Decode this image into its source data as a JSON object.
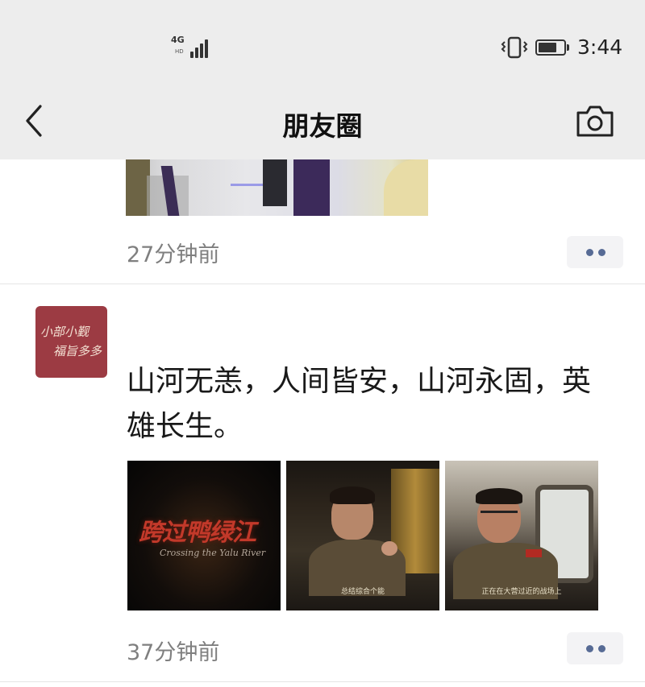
{
  "status_bar": {
    "network": "4G",
    "network_sub": "HD",
    "signal_icon": "signal-bars-icon",
    "vibrate_icon": "vibrate-icon",
    "battery_icon": "battery-icon",
    "battery_level": 0.6,
    "time": "3:44"
  },
  "nav": {
    "back_icon": "chevron-left-icon",
    "title": "朋友圈",
    "camera_icon": "camera-icon"
  },
  "feed": {
    "posts": [
      {
        "time": "27分钟前"
      },
      {
        "avatar_text": [
          "小部小觐",
          "福旨多多"
        ],
        "text": "山河无恙，人间皆安，山河永固，英雄长生。",
        "images": [
          {
            "title_text": "跨过鸭绿江",
            "subtitle_text": "Crossing the Yalu River"
          },
          {
            "caption": "总结综合个能"
          },
          {
            "caption": "正在在大营过近的战场上"
          }
        ],
        "time": "37分钟前"
      }
    ]
  },
  "colors": {
    "bar_bg": "#ededed",
    "link_blue": "#576b95",
    "time_gray": "#7f7f7f"
  }
}
